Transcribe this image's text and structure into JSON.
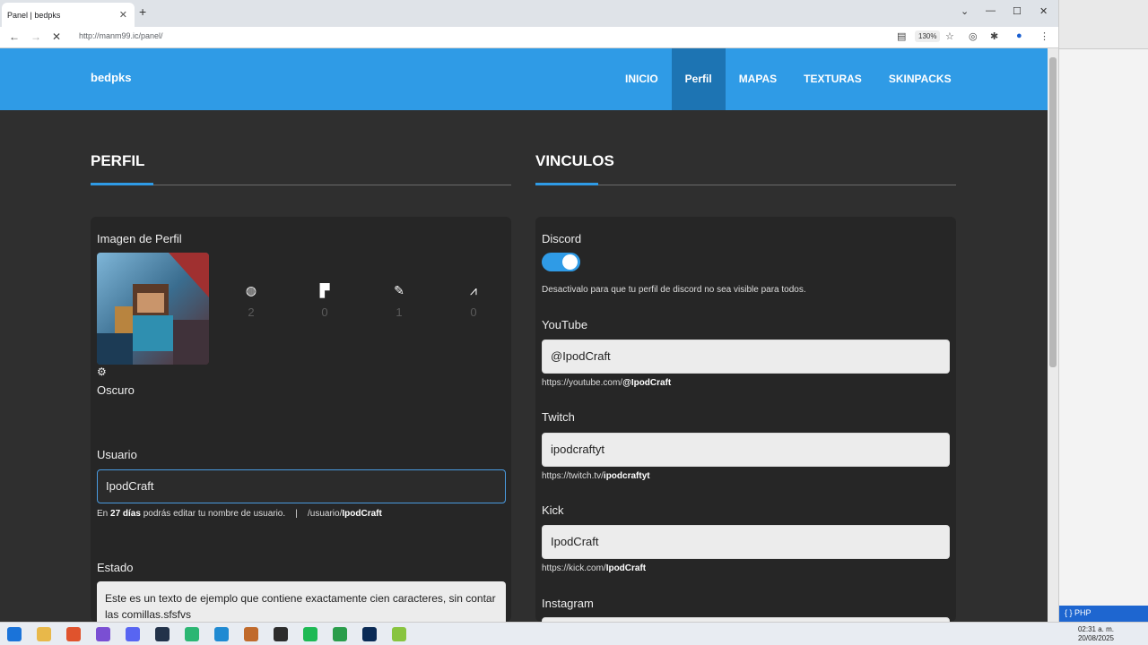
{
  "browser": {
    "tab_title": "Panel | bedpks",
    "url": "http://manm99.ic/panel/",
    "zoom": "130%"
  },
  "site": {
    "brand": "bedpks",
    "menu": [
      {
        "label": "INICIO",
        "active": false
      },
      {
        "label": "Perfil",
        "active": true
      },
      {
        "label": "MAPAS",
        "active": false
      },
      {
        "label": "TEXTURAS",
        "active": false
      },
      {
        "label": "SKINPACKS",
        "active": false
      }
    ]
  },
  "perfil": {
    "title": "PERFIL",
    "image_label": "Imagen de Perfil",
    "stats": [
      {
        "icon": "globe-icon",
        "value": "2"
      },
      {
        "icon": "paint-roller-icon",
        "value": "0"
      },
      {
        "icon": "brush-icon",
        "value": "1"
      },
      {
        "icon": "hanger-icon",
        "value": "0"
      }
    ],
    "theme_label": "Oscuro",
    "user_label": "Usuario",
    "username": "IpodCraft",
    "edit_note_pre": "En",
    "edit_note_days": "27 días",
    "edit_note_post": "podrás editar tu nombre de usuario.",
    "separator": "|",
    "user_path_pre": "/usuario/",
    "user_path_name": "IpodCraft",
    "estado_label": "Estado",
    "estado_text": "Este es un texto de ejemplo que contiene exactamente cien caracteres, sin contar las comillas.sfsfvs"
  },
  "vinculos": {
    "title": "VINCULOS",
    "discord_label": "Discord",
    "discord_enabled": true,
    "discord_note": "Desactivalo para que tu perfil de discord no sea visible para todos.",
    "youtube_label": "YouTube",
    "youtube_value": "@IpodCraft",
    "youtube_url_pre": "https://youtube.com/",
    "youtube_url_name": "@IpodCraft",
    "twitch_label": "Twitch",
    "twitch_value": "ipodcraftyt",
    "twitch_url_pre": "https://twitch.tv/",
    "twitch_url_name": "ipodcraftyt",
    "kick_label": "Kick",
    "kick_value": "IpodCraft",
    "kick_url_pre": "https://kick.com/",
    "kick_url_name": "IpodCraft",
    "instagram_label": "Instagram"
  },
  "taskbar": {
    "lang": "PHP",
    "time": "02:31 a. m.",
    "date": "20/08/2025"
  },
  "colors": {
    "accent": "#2f9be6",
    "accent_dark": "#1d74b3",
    "page_bg": "#2f2f2f",
    "card_bg": "#262626"
  }
}
